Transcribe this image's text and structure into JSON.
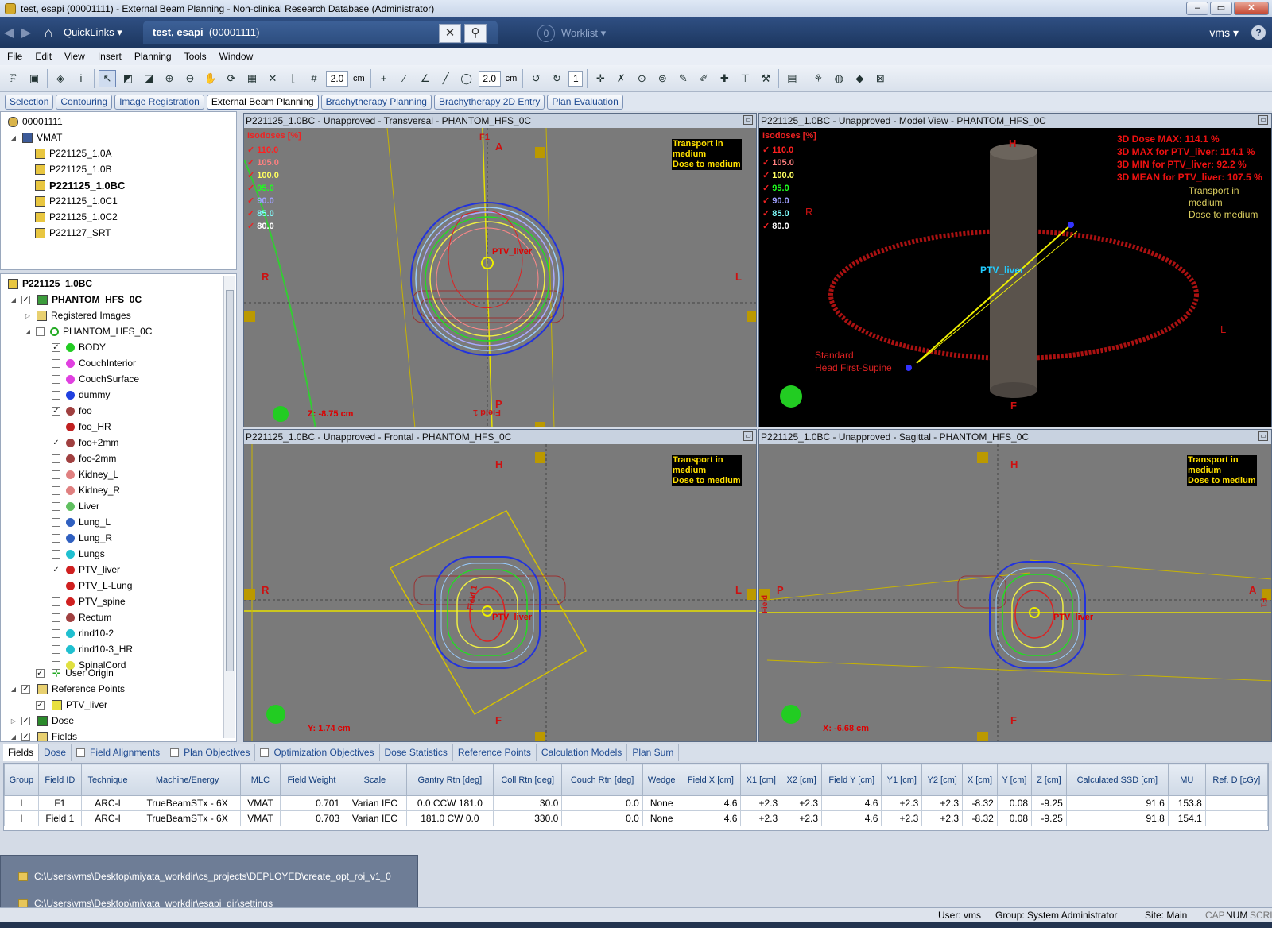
{
  "window": {
    "title": "test, esapi (00001111) - External Beam Planning - Non-clinical Research Database (Administrator)"
  },
  "nav": {
    "quicklinks": "QuickLinks ▾",
    "patient": "test, esapi",
    "patient_id": "(00001111)",
    "worklist_count": "0",
    "worklist": "Worklist ▾",
    "user": "vms ▾",
    "help": "?",
    "close_glyph": "✕",
    "search_glyph": "⚲"
  },
  "menu": {
    "items": [
      "File",
      "Edit",
      "View",
      "Insert",
      "Planning",
      "Tools",
      "Window"
    ]
  },
  "toolbar": {
    "zoom1": "2.0",
    "unit1": "cm",
    "zoom2": "2.0",
    "unit2": "cm",
    "count": "1"
  },
  "tasks": [
    "Selection",
    "Contouring",
    "Image Registration",
    "External Beam Planning",
    "Brachytherapy Planning",
    "Brachytherapy 2D Entry",
    "Plan Evaluation"
  ],
  "tree_top": {
    "root": "00001111",
    "course": "VMAT",
    "plans": [
      "P221125_1.0A",
      "P221125_1.0B",
      "P221125_1.0BC",
      "P221125_1.0C1",
      "P221125_1.0C2",
      "P221127_SRT"
    ]
  },
  "tree": {
    "plan": "P221125_1.0BC",
    "image": "PHANTOM_HFS_0C",
    "registered": "Registered Images",
    "set": "PHANTOM_HFS_0C",
    "structures": [
      {
        "name": "BODY",
        "checked": true,
        "color": "#22cc22"
      },
      {
        "name": "CouchInterior",
        "checked": false,
        "color": "#e040e0"
      },
      {
        "name": "CouchSurface",
        "checked": false,
        "color": "#e040e0"
      },
      {
        "name": "dummy",
        "checked": false,
        "color": "#2040e0"
      },
      {
        "name": "foo",
        "checked": true,
        "color": "#a04040"
      },
      {
        "name": "foo_HR",
        "checked": false,
        "color": "#c02020"
      },
      {
        "name": "foo+2mm",
        "checked": true,
        "color": "#a04040"
      },
      {
        "name": "foo-2mm",
        "checked": false,
        "color": "#a04040"
      },
      {
        "name": "Kidney_L",
        "checked": false,
        "color": "#e08080"
      },
      {
        "name": "Kidney_R",
        "checked": false,
        "color": "#e08080"
      },
      {
        "name": "Liver",
        "checked": false,
        "color": "#60c060"
      },
      {
        "name": "Lung_L",
        "checked": false,
        "color": "#3060c0"
      },
      {
        "name": "Lung_R",
        "checked": false,
        "color": "#3060c0"
      },
      {
        "name": "Lungs",
        "checked": false,
        "color": "#20c0d0"
      },
      {
        "name": "PTV_liver",
        "checked": true,
        "color": "#d02020"
      },
      {
        "name": "PTV_L-Lung",
        "checked": false,
        "color": "#d02020"
      },
      {
        "name": "PTV_spine",
        "checked": false,
        "color": "#d02020"
      },
      {
        "name": "Rectum",
        "checked": false,
        "color": "#a04040"
      },
      {
        "name": "rind10-2",
        "checked": false,
        "color": "#20c0d0"
      },
      {
        "name": "rind10-3_HR",
        "checked": false,
        "color": "#20c0d0"
      },
      {
        "name": "SpinalCord",
        "checked": false,
        "color": "#e0e040"
      }
    ],
    "user_origin": "User Origin",
    "ref_points": "Reference Points",
    "ref_ptv": "PTV_liver",
    "dose": "Dose",
    "fields": "Fields"
  },
  "views": {
    "transversal": {
      "title": "P221125_1.0BC  -  Unapproved - Transversal - PHANTOM_HFS_0C",
      "A": "A",
      "P": "P",
      "R": "R",
      "L": "L",
      "F1": "F1",
      "field1": "Field 1",
      "z": "Z: -8.75 cm",
      "ptv": "PTV_liver"
    },
    "model": {
      "title": "P221125_1.0BC  -  Unapproved - Model View - PHANTOM_HFS_0C",
      "H": "H",
      "F": "F",
      "R": "R",
      "L": "L",
      "ptv": "PTV_liver",
      "stats": [
        "3D Dose MAX: 114.1 %",
        "3D MAX for PTV_liver: 114.1 %",
        "3D MIN for PTV_liver: 92.2 %",
        "3D MEAN for PTV_liver: 107.5 %"
      ],
      "orient1": "Standard",
      "orient2": "Head First-Supine",
      "trans1": "Transport in",
      "trans2": "medium",
      "trans3": "Dose to medium"
    },
    "frontal": {
      "title": "P221125_1.0BC  -  Unapproved - Frontal - PHANTOM_HFS_0C",
      "H": "H",
      "F": "F",
      "R": "R",
      "L": "L",
      "field1": "Field 1",
      "y": "Y: 1.74 cm",
      "ptv": "PTV_liver"
    },
    "sagittal": {
      "title": "P221125_1.0BC  -  Unapproved - Sagittal - PHANTOM_HFS_0C",
      "H": "H",
      "F": "F",
      "P": "P",
      "A": "A",
      "x": "X: -6.68 cm",
      "ptv": "PTV_liver",
      "field": "Field",
      "f1": "F1"
    },
    "isodose_title": "Isodoses [%]",
    "isodoses": [
      {
        "v": "110.0",
        "c": "#ff2020"
      },
      {
        "v": "105.0",
        "c": "#ff8080"
      },
      {
        "v": "100.0",
        "c": "#ffff60"
      },
      {
        "v": "95.0",
        "c": "#20ff20"
      },
      {
        "v": "90.0",
        "c": "#a0a0ff"
      },
      {
        "v": "85.0",
        "c": "#80ffff"
      },
      {
        "v": "80.0",
        "c": "#ffffff"
      }
    ],
    "transport": {
      "l1": "Transport in",
      "l2": "medium",
      "l3": "Dose to medium"
    }
  },
  "tabs": [
    "Fields",
    "Dose",
    "Field Alignments",
    "Plan Objectives",
    "Optimization Objectives",
    "Dose Statistics",
    "Reference Points",
    "Calculation Models",
    "Plan Sum"
  ],
  "table": {
    "headers": [
      "Group",
      "Field ID",
      "Technique",
      "Machine/Energy",
      "MLC",
      "Field Weight",
      "Scale",
      "Gantry Rtn [deg]",
      "Coll Rtn [deg]",
      "Couch Rtn [deg]",
      "Wedge",
      "Field X [cm]",
      "X1 [cm]",
      "X2 [cm]",
      "Field Y [cm]",
      "Y1 [cm]",
      "Y2 [cm]",
      "X [cm]",
      "Y [cm]",
      "Z [cm]",
      "Calculated SSD [cm]",
      "MU",
      "Ref. D [cGy]"
    ],
    "rows": [
      [
        "I",
        "F1",
        "ARC-I",
        "TrueBeamSTx - 6X",
        "VMAT",
        "0.701",
        "Varian IEC",
        "0.0 CCW 181.0",
        "30.0",
        "0.0",
        "None",
        "4.6",
        "+2.3",
        "+2.3",
        "4.6",
        "+2.3",
        "+2.3",
        "-8.32",
        "0.08",
        "-9.25",
        "91.6",
        "153.8",
        ""
      ],
      [
        "I",
        "Field 1",
        "ARC-I",
        "TrueBeamSTx - 6X",
        "VMAT",
        "0.703",
        "Varian IEC",
        "181.0 CW 0.0",
        "330.0",
        "0.0",
        "None",
        "4.6",
        "+2.3",
        "+2.3",
        "4.6",
        "+2.3",
        "+2.3",
        "-8.32",
        "0.08",
        "-9.25",
        "91.8",
        "154.1",
        ""
      ]
    ]
  },
  "popup": {
    "p1": "C:\\Users\\vms\\Desktop\\miyata_workdir\\cs_projects\\DEPLOYED\\create_opt_roi_v1_0",
    "p2": "C:\\Users\\vms\\Desktop\\miyata_workdir\\esapi_dir\\settings"
  },
  "status": {
    "user": "User: vms",
    "group": "Group: System Administrator",
    "site": "Site: Main",
    "caps": "CAP",
    "num": "NUM",
    "scrl": "SCRL"
  }
}
